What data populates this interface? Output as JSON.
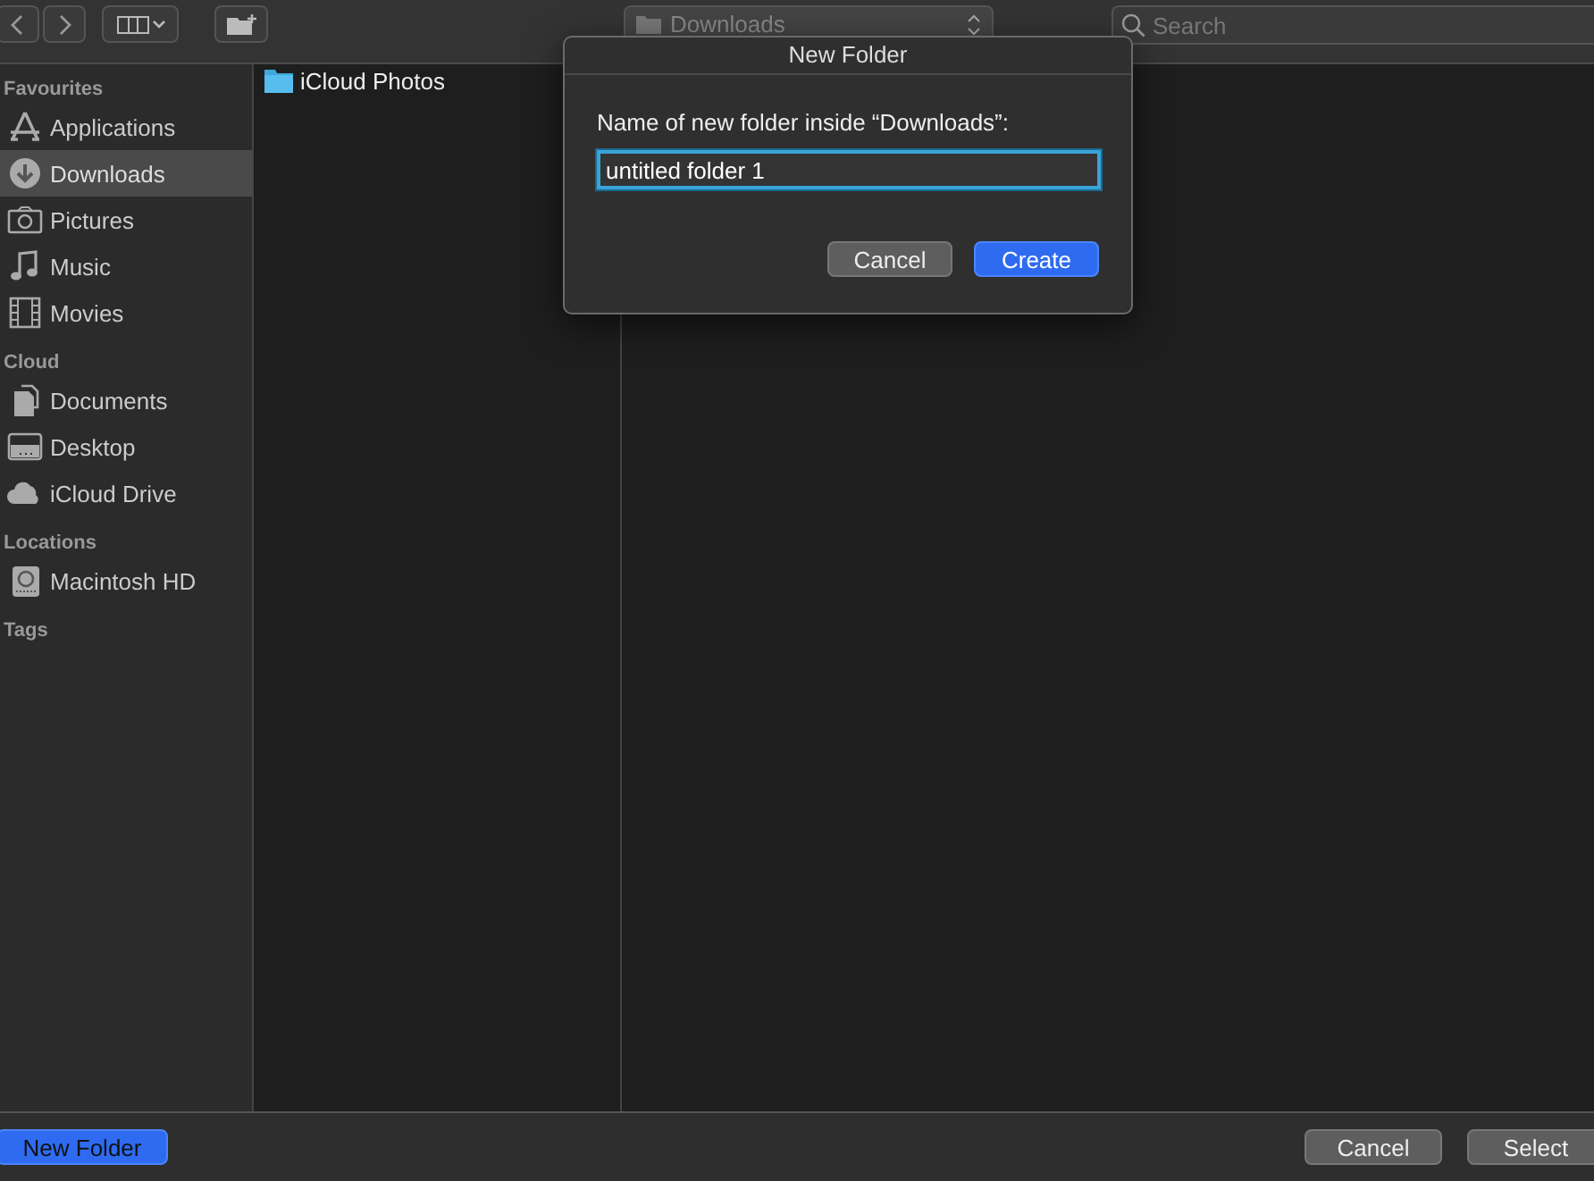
{
  "toolbar": {
    "path": "Downloads",
    "search": {
      "placeholder": "Search"
    }
  },
  "sidebar": [
    {
      "heading": "Favourites",
      "items": [
        {
          "label": "Applications",
          "kind": "apps",
          "selected": false
        },
        {
          "label": "Downloads",
          "kind": "download",
          "selected": true
        },
        {
          "label": "Pictures",
          "kind": "camera",
          "selected": false
        },
        {
          "label": "Music",
          "kind": "music",
          "selected": false
        },
        {
          "label": "Movies",
          "kind": "film",
          "selected": false
        }
      ]
    },
    {
      "heading": "Cloud",
      "items": [
        {
          "label": "Documents",
          "kind": "docs",
          "selected": false
        },
        {
          "label": "Desktop",
          "kind": "desktop",
          "selected": false
        },
        {
          "label": "iCloud Drive",
          "kind": "cloud",
          "selected": false
        }
      ]
    },
    {
      "heading": "Locations",
      "items": [
        {
          "label": "Macintosh HD",
          "kind": "disk",
          "selected": false
        }
      ]
    },
    {
      "heading": "Tags"
    }
  ],
  "files": [
    {
      "name": "iCloud Photos"
    }
  ],
  "dialog": {
    "title": "New Folder",
    "prompt": "Name of new folder inside “Downloads”:",
    "value": "untitled folder 1",
    "buttons": [
      {
        "label": "Cancel",
        "kind": "secondary"
      },
      {
        "label": "Create",
        "kind": "primary"
      }
    ]
  },
  "footer": {
    "left": {
      "label": "New Folder",
      "kind": "primary"
    },
    "right": [
      {
        "label": "Cancel",
        "kind": "secondary"
      },
      {
        "label": "Select",
        "kind": "secondary"
      }
    ]
  }
}
